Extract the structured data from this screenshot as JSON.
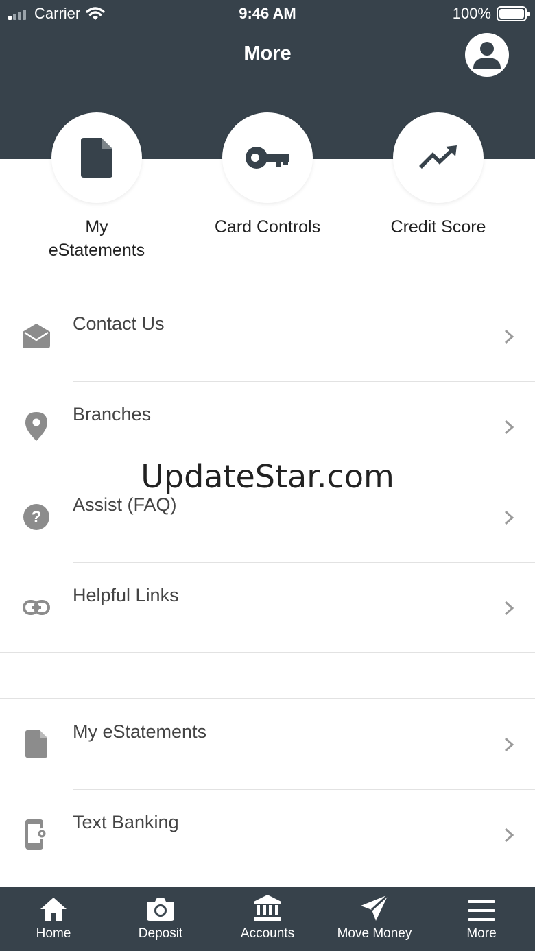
{
  "status_bar": {
    "carrier": "Carrier",
    "time": "9:46 AM",
    "battery": "100%",
    "signal_bars_active": 1
  },
  "header": {
    "title": "More",
    "background_color": "#37424b"
  },
  "quick_actions": [
    {
      "label": "My eStatements",
      "icon": "document-icon"
    },
    {
      "label": "Card Controls",
      "icon": "key-icon"
    },
    {
      "label": "Credit Score",
      "icon": "trending-up-icon"
    }
  ],
  "menu_group_1": [
    {
      "label": "Contact Us",
      "icon": "envelope-open-icon"
    },
    {
      "label": "Branches",
      "icon": "map-pin-icon"
    },
    {
      "label": "Assist (FAQ)",
      "icon": "help-circle-icon"
    },
    {
      "label": "Helpful Links",
      "icon": "link-icon"
    }
  ],
  "menu_group_2": [
    {
      "label": "My eStatements",
      "icon": "document-icon"
    },
    {
      "label": "Text Banking",
      "icon": "phone-settings-icon"
    }
  ],
  "watermark": "UpdateStar.com",
  "tab_bar": [
    {
      "label": "Home",
      "icon": "home-icon"
    },
    {
      "label": "Deposit",
      "icon": "camera-icon"
    },
    {
      "label": "Accounts",
      "icon": "bank-icon"
    },
    {
      "label": "Move Money",
      "icon": "send-icon"
    },
    {
      "label": "More",
      "icon": "menu-icon"
    }
  ]
}
